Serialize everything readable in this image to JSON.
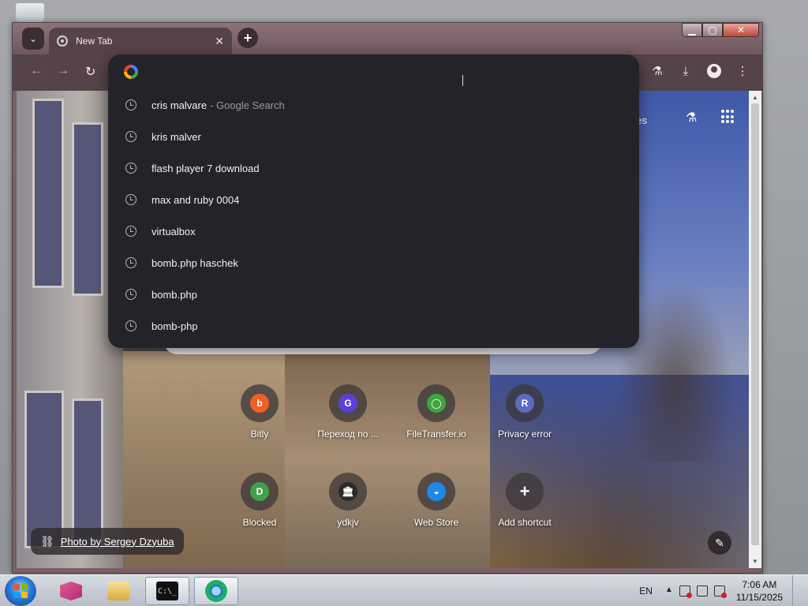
{
  "window": {
    "controls": {
      "minimize": "▁",
      "maximize": "▢",
      "close": "✕"
    }
  },
  "tabs": [
    {
      "title": "New Tab",
      "close": "✕"
    }
  ],
  "toolbar": {
    "back_icon": "←",
    "forward_icon": "→",
    "reload_icon": "↻",
    "labs_icon": "⚗",
    "download_icon": "⤓",
    "menu_icon": "⋮"
  },
  "omnibox": {
    "value": "",
    "suggestions": [
      {
        "text": "cris malvare",
        "extra": "- Google Search"
      },
      {
        "text": "kris malver",
        "extra": ""
      },
      {
        "text": "flash player 7 download",
        "extra": ""
      },
      {
        "text": "max and ruby 0004",
        "extra": ""
      },
      {
        "text": "virtualbox",
        "extra": ""
      },
      {
        "text": "bomb.php haschek",
        "extra": ""
      },
      {
        "text": "bomb.php",
        "extra": ""
      },
      {
        "text": "bomb-php",
        "extra": ""
      }
    ]
  },
  "ntp": {
    "images_link": "ges",
    "labs_icon": "⚗",
    "shortcuts": [
      {
        "label": "Bitly",
        "letter": "b",
        "color": "#ee6123"
      },
      {
        "label": "Переход по ...",
        "letter": "G",
        "color": "#5b3fd6"
      },
      {
        "label": "FileTransfer.io",
        "letter": "◯",
        "color": "#3aa83a"
      },
      {
        "label": "Privacy error",
        "letter": "R",
        "color": "#5c6bc0"
      },
      {
        "label": "Blocked",
        "letter": "D",
        "color": "#43a047"
      },
      {
        "label": "ydkjv",
        "letter": "🏛",
        "color": "#2b2b2b"
      },
      {
        "label": "Web Store",
        "letter": "◒",
        "color": "#1e88e5"
      },
      {
        "label": "Add shortcut",
        "letter": "+",
        "color": "transparent"
      }
    ],
    "photo_credit": "Photo by Sergey Dzyuba",
    "customize_icon": "✎"
  },
  "taskbar": {
    "cmd_prompt": "C:\\_",
    "language": "EN",
    "time": "7:06 AM",
    "date": "11/15/2025"
  }
}
